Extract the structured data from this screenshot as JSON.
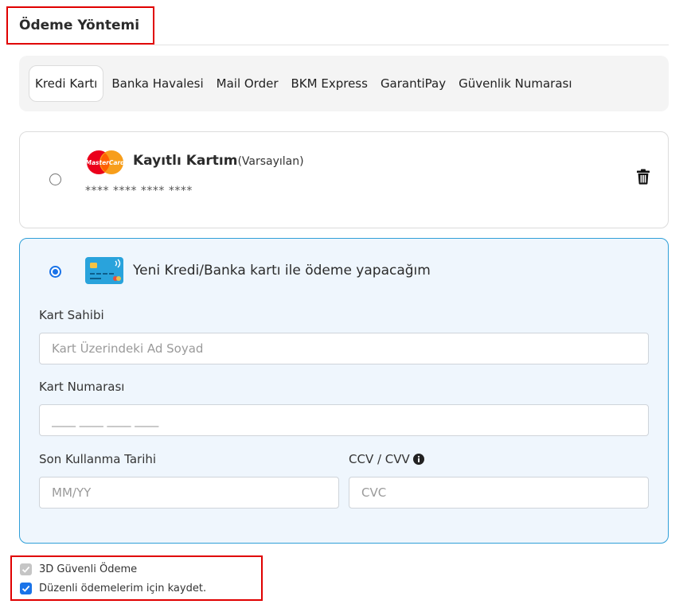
{
  "section": {
    "title": "Ödeme Yöntemi"
  },
  "tabs": [
    {
      "label": "Kredi Kartı",
      "active": true
    },
    {
      "label": "Banka Havalesi",
      "active": false
    },
    {
      "label": "Mail Order",
      "active": false
    },
    {
      "label": "BKM Express",
      "active": false
    },
    {
      "label": "GarantiPay",
      "active": false
    },
    {
      "label": "Güvenlik Numarası",
      "active": false
    }
  ],
  "saved_card": {
    "selected": false,
    "brand_icon": "mastercard-logo",
    "brand_logo_text": "MasterCard",
    "title": "Kayıtlı Kartım",
    "default_label": "(Varsayılan)",
    "masked_number": "**** **** **** ****",
    "delete_icon": "trash-icon"
  },
  "new_card": {
    "selected": true,
    "icon": "credit-card-icon",
    "title": "Yeni Kredi/Banka kartı ile ödeme yapacağım",
    "holder": {
      "label": "Kart Sahibi",
      "placeholder": "Kart Üzerindeki Ad Soyad",
      "value": ""
    },
    "number": {
      "label": "Kart Numarası",
      "placeholder": "____ ____ ____ ____",
      "value": ""
    },
    "expiry": {
      "label": "Son Kullanma Tarihi",
      "placeholder": "MM/YY",
      "value": ""
    },
    "cvv": {
      "label": "CCV / CVV",
      "placeholder": "CVC",
      "value": "",
      "info_icon": "info-icon"
    }
  },
  "options": {
    "secure_3d": {
      "label": "3D Güvenli Ödeme",
      "checked": true,
      "disabled": true
    },
    "save_recurring": {
      "label": "Düzenli ödemelerim için kaydet.",
      "checked": true,
      "disabled": false
    }
  },
  "colors": {
    "accent": "#1a73e8",
    "highlight_border": "#e00000",
    "selected_card_bg": "#eff6fd",
    "selected_card_border": "#2f9fd8"
  }
}
